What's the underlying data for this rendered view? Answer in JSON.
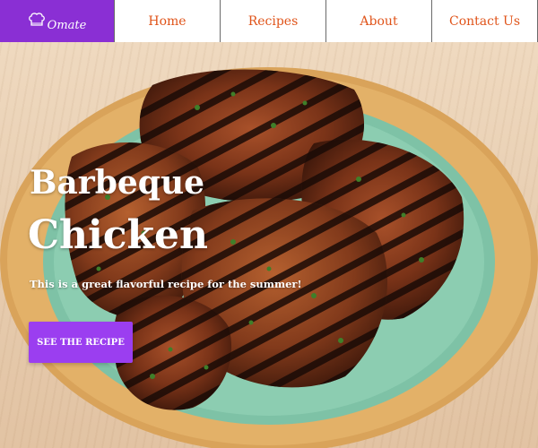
{
  "brand": {
    "logo_text": "Omate",
    "logo_icon": "chef-hat-icon",
    "color": "#8a2fd4"
  },
  "nav": {
    "items": [
      {
        "label": "Home"
      },
      {
        "label": "Recipes"
      },
      {
        "label": "About"
      },
      {
        "label": "Contact Us"
      }
    ],
    "link_color": "#e0541a"
  },
  "hero": {
    "title_line1": "Barbeque",
    "title_line2": "Chicken",
    "subtitle": "This is a great flavorful recipe for the summer!",
    "cta_label": "SEE THE RECIPE",
    "cta_color": "#9b3ef0",
    "image": "grilled-chicken-plate"
  }
}
